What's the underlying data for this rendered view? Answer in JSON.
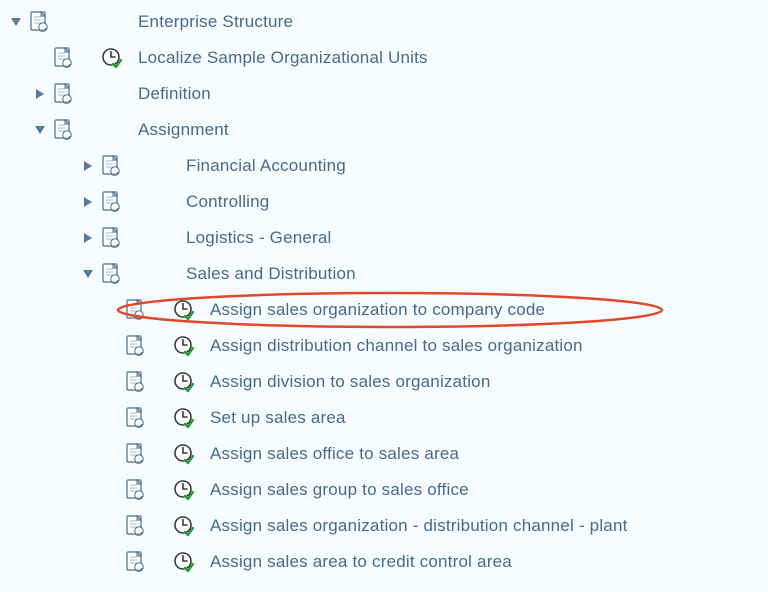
{
  "tree": {
    "root": {
      "label": "Enterprise Structure"
    },
    "localize": {
      "label": "Localize Sample Organizational Units"
    },
    "definition": {
      "label": "Definition"
    },
    "assignment": {
      "label": "Assignment"
    },
    "fi": {
      "label": "Financial Accounting"
    },
    "co": {
      "label": "Controlling"
    },
    "lg": {
      "label": "Logistics - General"
    },
    "sd": {
      "label": "Sales and Distribution"
    },
    "sd_items": [
      {
        "label": "Assign sales organization to company code"
      },
      {
        "label": "Assign distribution channel to sales organization"
      },
      {
        "label": "Assign division to sales organization"
      },
      {
        "label": "Set up sales area"
      },
      {
        "label": "Assign sales office to sales area"
      },
      {
        "label": "Assign sales group to sales office"
      },
      {
        "label": "Assign sales organization - distribution channel - plant"
      },
      {
        "label": "Assign sales area to credit control area"
      }
    ]
  },
  "highlight_index": 0
}
